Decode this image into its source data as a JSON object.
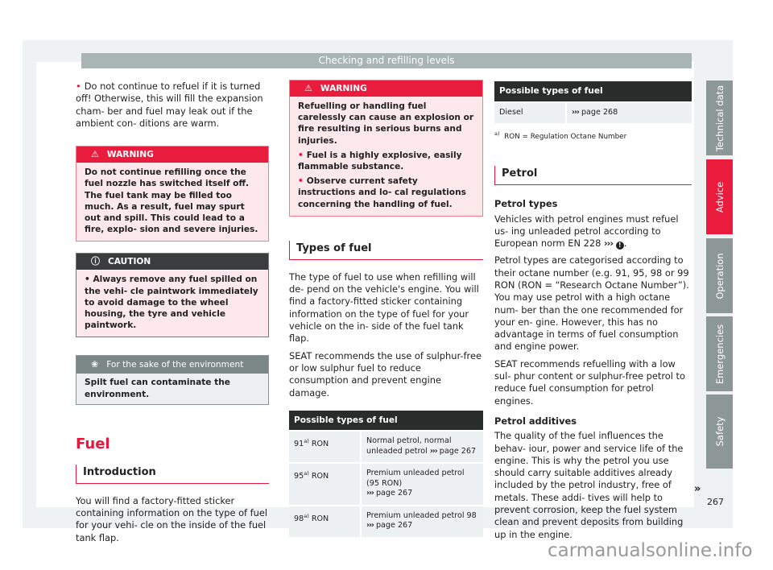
{
  "header": {
    "title": "Checking and refilling levels"
  },
  "col1": {
    "intro_bullet": "Do not continue to refuel if it is turned off! Otherwise, this will fill the expansion cham- ber and fuel may leak out if the ambient con- ditions are warm.",
    "warning": {
      "title": "WARNING",
      "text": "Do not continue refilling once the fuel nozzle has switched itself off. The fuel tank may be filled too much. As a result, fuel may spurt out and spill. This could lead to a fire, explo- sion and severe injuries."
    },
    "caution": {
      "title": "CAUTION",
      "text": "Always remove any fuel spilled on the vehi- cle paintwork immediately to avoid damage to the wheel housing, the tyre and vehicle paintwork."
    },
    "environment": {
      "title": "For the sake of the environment",
      "text": "Spilt fuel can contaminate the environment."
    },
    "section_title": "Fuel",
    "subsection_title": "Introduction",
    "intro_text": "You will find a factory-fitted sticker containing information on the type of fuel for your vehi- cle on the inside of the fuel tank flap."
  },
  "col2": {
    "warning": {
      "title": "WARNING",
      "text": "Refuelling or handling fuel carelessly can cause an explosion or fire resulting in serious burns and injuries.",
      "bullets": [
        "Fuel is a highly explosive, easily flammable substance.",
        "Observe current safety instructions and lo- cal regulations concerning the handling of fuel."
      ]
    },
    "subsection_title": "Types of fuel",
    "para1": "The type of fuel to use when refilling will de- pend on the vehicle's engine. You will find a factory-fitted sticker containing information on the type of fuel for your vehicle on the in- side of the fuel tank flap.",
    "para2": "SEAT recommends the use of sulphur-free or low sulphur fuel to reduce consumption and prevent engine damage.",
    "table": {
      "header": "Possible types of fuel",
      "rows": [
        {
          "octane": "91",
          "sup": "a)",
          "unit": "RON",
          "desc": "Normal petrol, normal unleaded petrol",
          "ref": "›››",
          "page": "page 267"
        },
        {
          "octane": "95",
          "sup": "a)",
          "unit": "RON",
          "desc": "Premium unleaded petrol (95 RON)",
          "ref": "›››",
          "page": "page 267"
        },
        {
          "octane": "98",
          "sup": "a)",
          "unit": "RON",
          "desc": "Premium unleaded petrol 98",
          "ref": "›››",
          "page": "page 267"
        }
      ]
    }
  },
  "col3": {
    "table": {
      "header": "Possible types of fuel",
      "rows": [
        {
          "type": "Diesel",
          "ref": "›››",
          "page": "page 268"
        }
      ]
    },
    "footnote": {
      "mark": "a)",
      "text": "RON = Regulation Octane Number"
    },
    "subsection_title": "Petrol",
    "petrol_types_heading": "Petrol types",
    "petrol_types_text": "Vehicles with petrol engines must refuel us- ing unleaded petrol according to European norm EN 228",
    "petrol_types_ref": "›››",
    "petrol_types_ref_icon": "!",
    "para2": "Petrol types are categorised according to their octane number (e.g. 91, 95, 98 or 99 RON (RON = “Research Octane Number”). You may use petrol with a high octane num- ber than the one recommended for your en- gine. However, this has no advantage in terms of fuel consumption and engine power.",
    "para3": "SEAT recommends refuelling with a low sul- phur content or sulphur-free petrol to reduce fuel consumption for petrol engines.",
    "additives_heading": "Petrol additives",
    "additives_text": "The quality of the fuel influences the behav- iour, power and service life of the engine. This is why the petrol you use should carry suitable additives already included by the petrol industry, free of metals. These addi- tives will help to prevent corrosion, keep the fuel system clean and prevent deposits from building up in the engine."
  },
  "continue_mark": "»",
  "side_tabs": [
    {
      "label": "Technical data",
      "active": false
    },
    {
      "label": "Advice",
      "active": true
    },
    {
      "label": "Operation",
      "active": false
    },
    {
      "label": "Emergencies",
      "active": false
    },
    {
      "label": "Safety",
      "active": false
    }
  ],
  "page_number": "267",
  "watermark": "carmanualsonline.info",
  "colors": {
    "accent_red": "#ea1c3e",
    "tab_gray": "#8d9896",
    "header_gray": "#a8b5b3"
  }
}
